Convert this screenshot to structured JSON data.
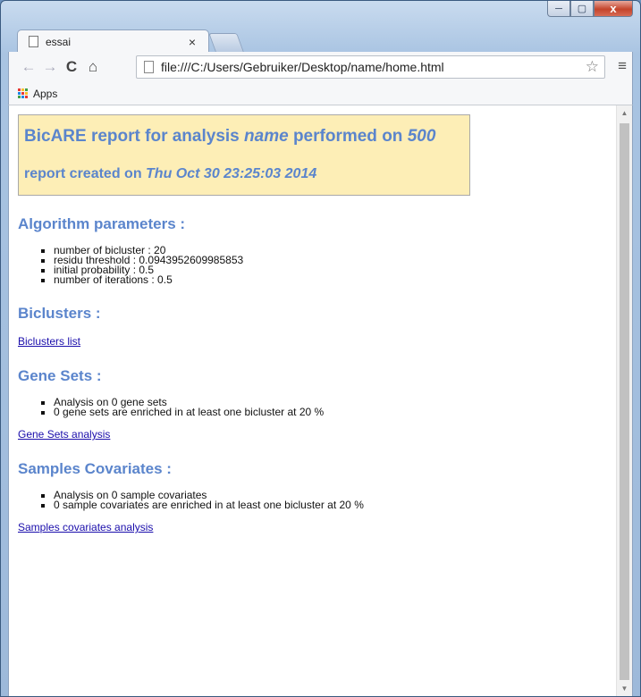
{
  "window": {
    "controls": {
      "minimize": "─",
      "maximize": "▢",
      "close": "x"
    }
  },
  "tab": {
    "title": "essai",
    "close": "×"
  },
  "toolbar": {
    "back": "←",
    "forward": "→",
    "reload": "C",
    "home": "⌂",
    "url": "file:///C:/Users/Gebruiker/Desktop/name/home.html",
    "star": "☆",
    "menu": "≡"
  },
  "bookmarks": {
    "apps_label": "Apps"
  },
  "report": {
    "title_prefix": "BicARE report for analysis ",
    "analysis_name": "name",
    "title_middle": " performed on ",
    "performed_on": "500",
    "created_prefix": "report created on ",
    "created_on": "Thu Oct 30 23:25:03 2014"
  },
  "algorithm": {
    "heading": "Algorithm parameters :",
    "items": [
      "number of bicluster : 20",
      "residu threshold : 0.0943952609985853",
      "initial probability : 0.5",
      "number of iterations : 0.5"
    ]
  },
  "biclusters": {
    "heading": "Biclusters :",
    "link": "Biclusters list"
  },
  "gene_sets": {
    "heading": "Gene Sets :",
    "items": [
      "Analysis on 0 gene sets",
      "0 gene sets are enriched in at least one bicluster at 20 %"
    ],
    "link": "Gene Sets analysis"
  },
  "samples": {
    "heading": "Samples Covariates :",
    "items": [
      "Analysis on 0 sample covariates",
      "0 sample covariates are enriched in at least one bicluster at 20 %"
    ],
    "link": "Samples covariates analysis"
  },
  "colors": {
    "heading": "#5b85cc",
    "report_bg": "#fdeeb6",
    "link": "#1a0dab"
  }
}
